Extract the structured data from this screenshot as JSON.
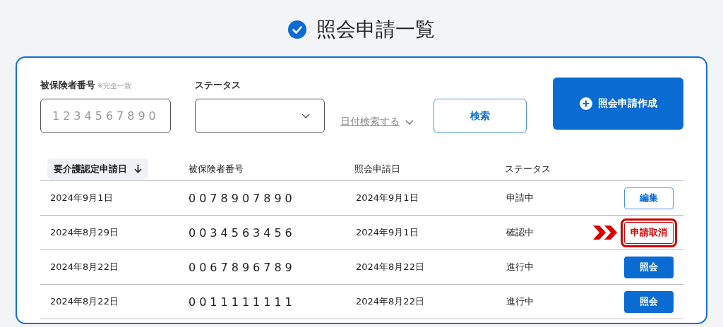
{
  "page_title": "照会申請一覧",
  "filters": {
    "insured_number": {
      "label": "被保険者番号",
      "note": "※完全一致",
      "placeholder": "1234567890"
    },
    "status": {
      "label": "ステータス"
    },
    "date_search": "日付検索する",
    "search_button": "検索",
    "create_button": "照会申請作成"
  },
  "table": {
    "columns": [
      {
        "label": "要介護認定申請日",
        "sorted": true
      },
      {
        "label": "被保険者番号",
        "sorted": false
      },
      {
        "label": "照会申請日",
        "sorted": false
      },
      {
        "label": "ステータス",
        "sorted": false
      }
    ],
    "rows": [
      {
        "cells": [
          "2024年9月1日",
          "0078907890",
          "2024年9月1日",
          "申請中"
        ],
        "action": {
          "kind": "edit",
          "label": "編集",
          "callout": false
        }
      },
      {
        "cells": [
          "2024年8月29日",
          "0034563456",
          "2024年9月1日",
          "確認中"
        ],
        "action": {
          "kind": "cancel",
          "label": "申請取消",
          "callout": true
        }
      },
      {
        "cells": [
          "2024年8月22日",
          "0067896789",
          "2024年8月22日",
          "進行中"
        ],
        "action": {
          "kind": "inquiry",
          "label": "照会",
          "callout": false
        }
      },
      {
        "cells": [
          "2024年8月22日",
          "0011111111",
          "2024年8月22日",
          "進行中"
        ],
        "action": {
          "kind": "inquiry",
          "label": "照会",
          "callout": false
        }
      }
    ]
  }
}
